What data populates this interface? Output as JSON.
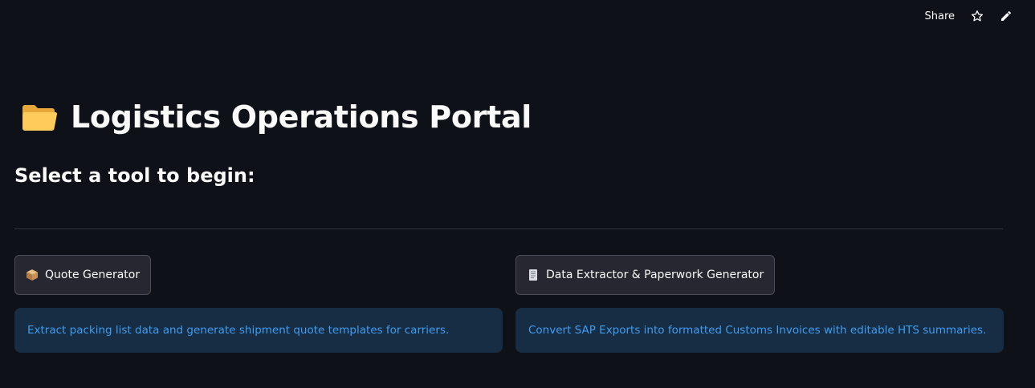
{
  "header": {
    "share_label": "Share"
  },
  "main": {
    "title": "Logistics Operations Portal",
    "subtitle": "Select a tool to begin:"
  },
  "tools": [
    {
      "button_label": "Quote Generator",
      "icon": "package-icon",
      "description": "Extract packing list data and generate shipment quote templates for carriers."
    },
    {
      "button_label": "Data Extractor & Paperwork Generator",
      "icon": "document-icon",
      "description": "Convert SAP Exports into formatted Customs Invoices with editable HTS summaries."
    }
  ],
  "colors": {
    "background": "#0e1117",
    "button_bg": "#262730",
    "info_bg": "#172d43",
    "info_text": "#3d9df3"
  }
}
